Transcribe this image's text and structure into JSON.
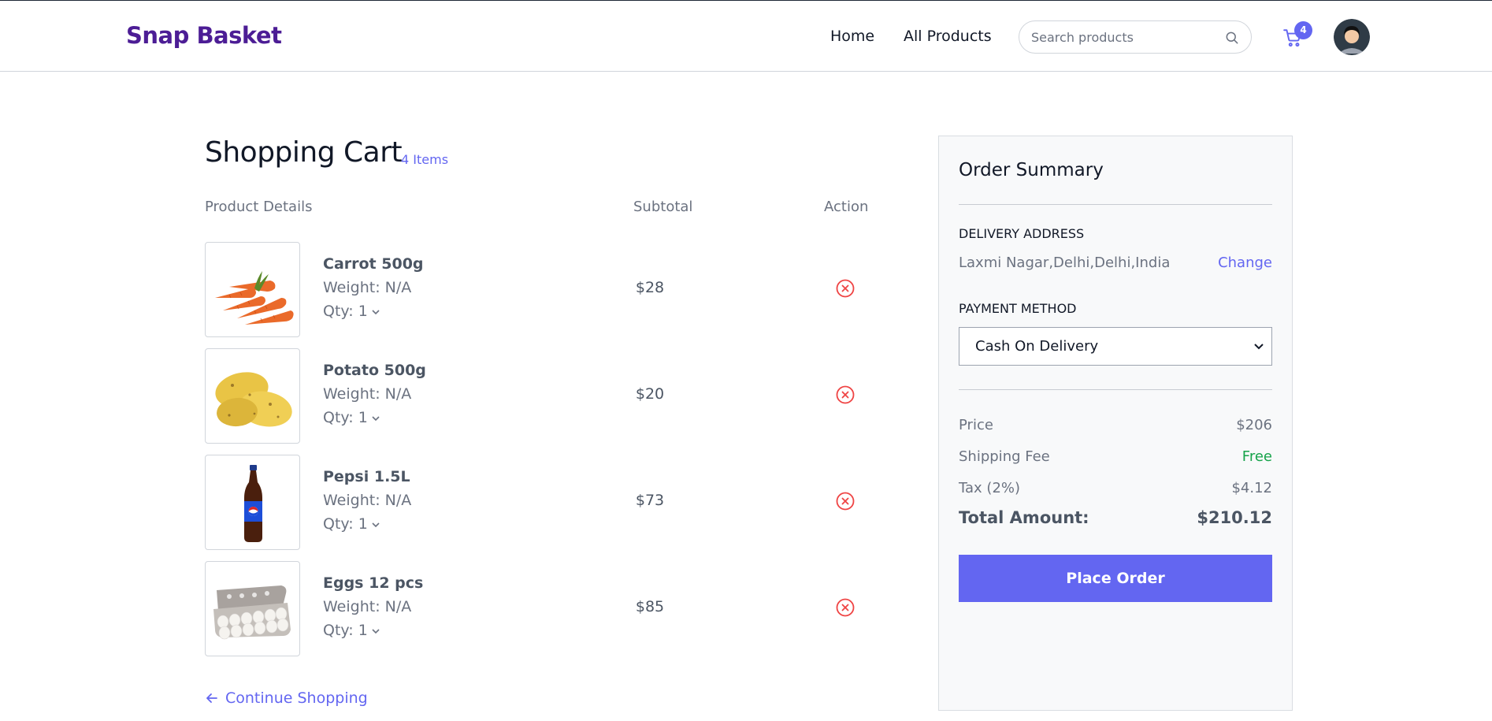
{
  "brand": {
    "logo": "Snap Basket",
    "color": "#4c1d95",
    "accent": "#6366f1"
  },
  "nav": {
    "links": [
      "Home",
      "All Products"
    ],
    "search": {
      "placeholder": "Search products",
      "value": ""
    },
    "cart_count": "4"
  },
  "cart": {
    "title": "Shopping Cart",
    "count_label": "4 Items",
    "columns": {
      "product": "Product Details",
      "subtotal": "Subtotal",
      "action": "Action"
    },
    "items": [
      {
        "name": "Carrot 500g",
        "weight": "Weight: N/A",
        "qty": "Qty: 1",
        "subtotal": "$28",
        "image": "carrots"
      },
      {
        "name": "Potato 500g",
        "weight": "Weight: N/A",
        "qty": "Qty: 1",
        "subtotal": "$20",
        "image": "potatoes"
      },
      {
        "name": "Pepsi 1.5L",
        "weight": "Weight: N/A",
        "qty": "Qty: 1",
        "subtotal": "$73",
        "image": "pepsi-bottle"
      },
      {
        "name": "Eggs 12 pcs",
        "weight": "Weight: N/A",
        "qty": "Qty: 1",
        "subtotal": "$85",
        "image": "egg-carton"
      }
    ],
    "continue_label": "Continue Shopping"
  },
  "summary": {
    "title": "Order Summary",
    "address_label": "DELIVERY ADDRESS",
    "address": "Laxmi Nagar,Delhi,Delhi,India",
    "change_label": "Change",
    "payment_label": "PAYMENT METHOD",
    "payment_selected": "Cash On Delivery",
    "price_label": "Price",
    "price": "$206",
    "shipping_label": "Shipping Fee",
    "shipping": "Free",
    "tax_label": "Tax (2%)",
    "tax": "$4.12",
    "total_label": "Total Amount:",
    "total": "$210.12",
    "place_order_label": "Place Order"
  }
}
